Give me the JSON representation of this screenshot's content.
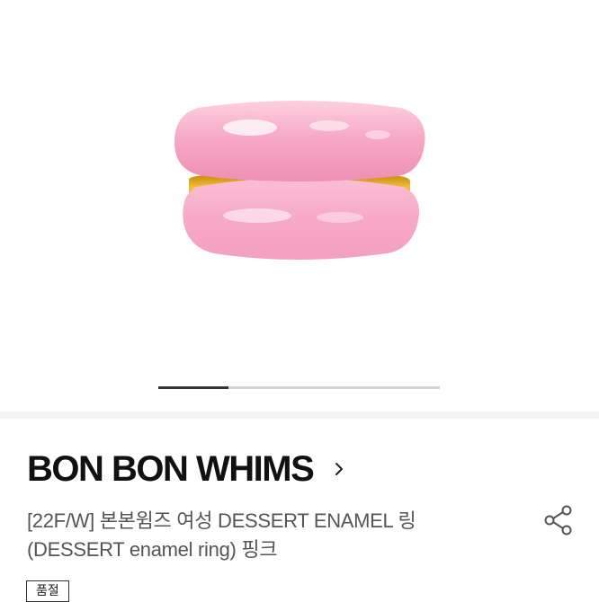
{
  "product_image": {
    "subject": "ring-icon",
    "colors": {
      "enamel": "#f7a7c5",
      "gold": "#e8b020",
      "background": "#ffffff"
    }
  },
  "gallery": {
    "current_fraction": 0.25
  },
  "brand": {
    "name": "BON BON WHIMS",
    "chevron_icon": "chevron-right-icon"
  },
  "product": {
    "title_line1": "[22F/W] 본본윔즈 여성 DESSERT ENAMEL 링",
    "title_line2": "(DESSERT enamel ring) 핑크"
  },
  "share": {
    "icon": "share-icon"
  },
  "tag": {
    "label": "품절"
  }
}
